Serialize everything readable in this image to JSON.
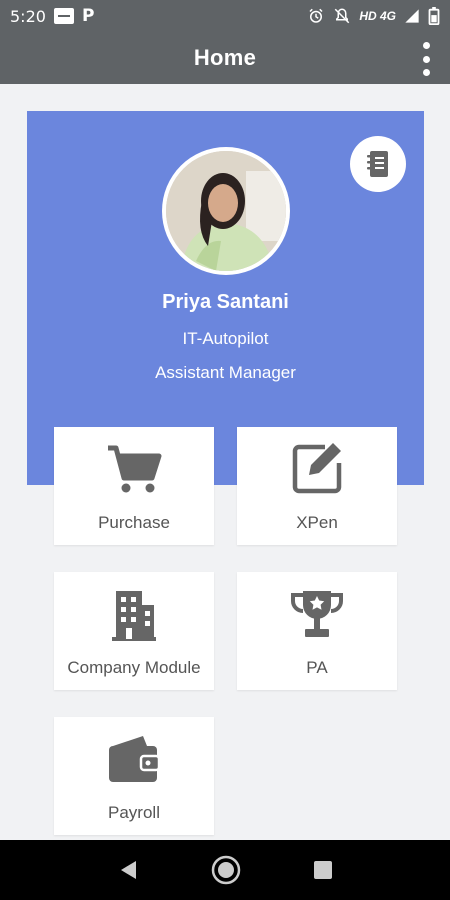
{
  "status_bar": {
    "time": "5:20",
    "notif_app": "P",
    "network": "HD 4G"
  },
  "app_bar": {
    "title": "Home"
  },
  "profile": {
    "name": "Priya Santani",
    "department": "IT-Autopilot",
    "designation": "Assistant Manager"
  },
  "modules": [
    {
      "label": "Purchase",
      "icon": "shopping-cart-icon"
    },
    {
      "label": "XPen",
      "icon": "edit-icon"
    },
    {
      "label": "Company Module",
      "icon": "building-icon"
    },
    {
      "label": "PA",
      "icon": "trophy-icon"
    },
    {
      "label": "Payroll",
      "icon": "wallet-icon"
    }
  ],
  "colors": {
    "header": "#5f6366",
    "profile_card": "#6b86dd",
    "icon": "#666666",
    "background": "#f1f2f4"
  }
}
